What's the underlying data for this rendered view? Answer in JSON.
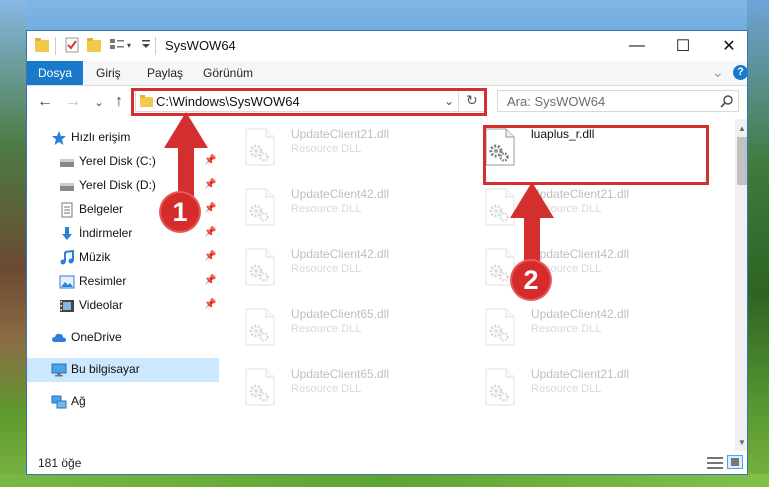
{
  "window": {
    "title": "SysWOW64",
    "minimize_symbol": "—",
    "maximize_symbol": "☐",
    "close_symbol": "✕"
  },
  "ribbon": {
    "tabs": [
      {
        "label": "Dosya"
      },
      {
        "label": "Giriş"
      },
      {
        "label": "Paylaş"
      },
      {
        "label": "Görünüm"
      }
    ],
    "expand_symbol": "⌄",
    "help_symbol": "?"
  },
  "nav": {
    "back_symbol": "←",
    "forward_symbol": "→",
    "recent_symbol": "⌄",
    "up_symbol": "↑",
    "address": "C:\\Windows\\SysWOW64",
    "refresh_symbol": "↻",
    "search_placeholder": "Ara: SysWOW64"
  },
  "sidebar": {
    "items": [
      {
        "label": "Hızlı erişim",
        "icon": "star-icon"
      },
      {
        "label": "Yerel Disk (C:)",
        "icon": "drive-icon",
        "pinned": true
      },
      {
        "label": "Yerel Disk (D:)",
        "icon": "drive-icon",
        "pinned": true
      },
      {
        "label": "Belgeler",
        "icon": "documents-icon",
        "pinned": true
      },
      {
        "label": "İndirmeler",
        "icon": "download-icon",
        "pinned": true
      },
      {
        "label": "Müzik",
        "icon": "music-icon",
        "pinned": true
      },
      {
        "label": "Resimler",
        "icon": "pictures-icon",
        "pinned": true
      },
      {
        "label": "Videolar",
        "icon": "videos-icon",
        "pinned": true
      },
      {
        "label": "OneDrive",
        "icon": "cloud-icon"
      },
      {
        "label": "Bu bilgisayar",
        "icon": "computer-icon",
        "selected": true
      },
      {
        "label": "Ağ",
        "icon": "network-icon"
      }
    ]
  },
  "files": [
    {
      "name": "UpdateClient21.dll",
      "type": "Resource DLL",
      "faded": true
    },
    {
      "name": "luaplus_r.dll",
      "type": "",
      "faded": false,
      "highlighted": true
    },
    {
      "name": "UpdateClient42.dll",
      "type": "Resource DLL",
      "faded": true
    },
    {
      "name": "UpdateClient21.dll",
      "type": "Resource DLL",
      "faded": true
    },
    {
      "name": "UpdateClient42.dll",
      "type": "Resource DLL",
      "faded": true
    },
    {
      "name": "UpdateClient42.dll",
      "type": "Resource DLL",
      "faded": true
    },
    {
      "name": "UpdateClient65.dll",
      "type": "Resource DLL",
      "faded": true
    },
    {
      "name": "UpdateClient42.dll",
      "type": "Resource DLL",
      "faded": true
    },
    {
      "name": "UpdateClient65.dll",
      "type": "Resource DLL",
      "faded": true
    },
    {
      "name": "UpdateClient21.dll",
      "type": "Resource DLL",
      "faded": true
    }
  ],
  "status": {
    "item_count": "181 öğe"
  },
  "annotations": {
    "step1": "1",
    "step2": "2",
    "color": "#d32f2f"
  }
}
